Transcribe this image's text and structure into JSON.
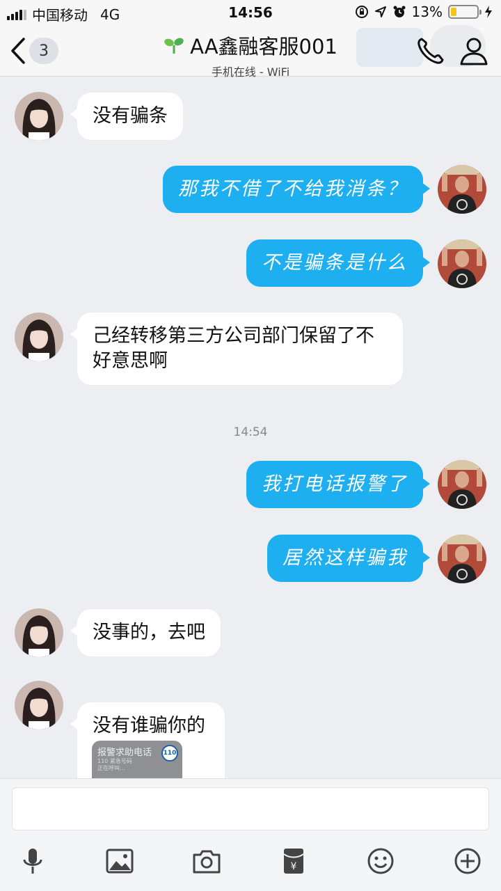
{
  "status_bar": {
    "carrier": "中国移动",
    "network": "4G",
    "time": "14:56",
    "battery_percent": "13%",
    "battery_level": 0.13,
    "icons": [
      "signal-icon",
      "orientation-lock-icon",
      "location-icon",
      "alarm-icon",
      "battery-icon",
      "charging-icon"
    ]
  },
  "header": {
    "unread_count": "3",
    "title": "AA鑫融客服001",
    "subtitle": "手机在线 - WiFi",
    "icons": [
      "back-chevron-icon",
      "sprout-icon",
      "phone-icon",
      "person-icon"
    ]
  },
  "messages": [
    {
      "dir": "in",
      "text": "没有骗条"
    },
    {
      "dir": "out",
      "text": "那我不借了不给我消条？"
    },
    {
      "dir": "out",
      "text": "不是骗条是什么"
    },
    {
      "dir": "in",
      "text": "己经转移第三方公司部门保留了不好意思啊"
    },
    {
      "dir": "out",
      "text": "我打电话报警了"
    },
    {
      "dir": "out",
      "text": "居然这样骗我"
    },
    {
      "dir": "in",
      "text": "没事的，去吧"
    },
    {
      "dir": "in",
      "text": "没有谁骗你的"
    }
  ],
  "timestamp": "14:54",
  "call_card": {
    "title": "报警求助电话",
    "line1": "110 紧急号码",
    "line2": "正在呼叫...",
    "badge": "110"
  },
  "input": {
    "placeholder": ""
  },
  "toolbar": {
    "icons": [
      "microphone-icon",
      "image-icon",
      "camera-icon",
      "red-packet-icon",
      "emoji-icon",
      "plus-icon"
    ]
  },
  "colors": {
    "outgoing_bubble": "#1eaff0",
    "incoming_bubble": "#ffffff",
    "background": "#eceef2"
  }
}
